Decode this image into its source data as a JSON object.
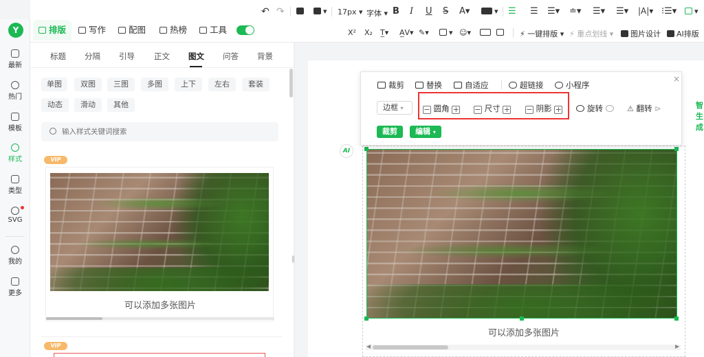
{
  "rail": {
    "logo": "Y",
    "items": [
      {
        "label": "最新"
      },
      {
        "label": "热门"
      },
      {
        "label": "模板"
      },
      {
        "label": "样式"
      },
      {
        "label": "类型"
      },
      {
        "label": "SVG"
      },
      {
        "label": "我的"
      },
      {
        "label": "更多"
      }
    ]
  },
  "top": {
    "tabs": [
      "排版",
      "写作",
      "配图",
      "热榜",
      "工具"
    ],
    "font_size": "17px",
    "font_family": "字体",
    "row2": {
      "one_click": "一键排版",
      "highlight": "重点划线",
      "image_design": "图片设计",
      "ai_layout": "AI排版"
    }
  },
  "sidebar": {
    "subtabs": [
      "标题",
      "分隔",
      "引导",
      "正文",
      "图文",
      "问答",
      "背景"
    ],
    "chips_row1": [
      "单图",
      "双图",
      "三图",
      "多图",
      "上下",
      "左右",
      "套装"
    ],
    "chips_row2": [
      "动态",
      "滑动",
      "其他"
    ],
    "search_placeholder": "输入样式关键词搜索",
    "vip": "VIP",
    "card_caption": "可以添加多张图片"
  },
  "float": {
    "crop": "裁剪",
    "replace": "替换",
    "fit": "自适应",
    "hyperlink": "超链接",
    "mini_program": "小程序",
    "border": "边框",
    "corner": "圆角",
    "size": "尺寸",
    "shadow": "阴影",
    "rotate": "旋转",
    "flip": "翻转",
    "crop_btn": "裁剪",
    "edit_btn": "编辑",
    "close": "×",
    "minus": "−",
    "plus": "+"
  },
  "editor": {
    "side_text": "智生成",
    "avatar": "AI",
    "caption": "可以添加多张图片"
  },
  "colors": {
    "accent": "#1cb954",
    "highlight_box": "#e33333",
    "vip": "#f7b96a"
  }
}
